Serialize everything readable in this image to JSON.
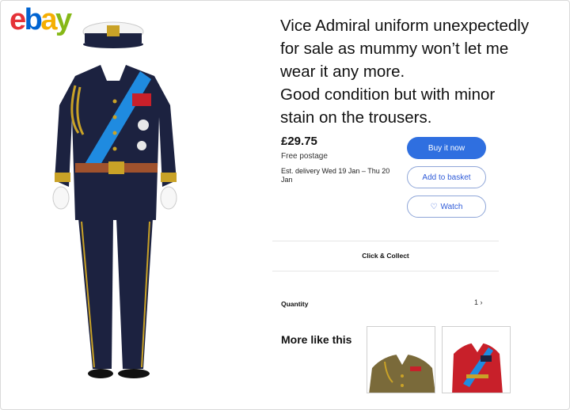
{
  "logo": {
    "letters": [
      "e",
      "b",
      "a",
      "y"
    ],
    "colors": [
      "#e53238",
      "#0064d2",
      "#f5af02",
      "#86b817"
    ]
  },
  "listing": {
    "title_lines": [
      "Vice Admiral uniform unexpectedly",
      "for sale as mummy won’t let me",
      "wear it any more.",
      "Good condition but with minor",
      "stain on the trousers."
    ],
    "price": "£29.75",
    "postage": "Free postage",
    "delivery": "Est. delivery Wed 19 Jan – Thu 20 Jan"
  },
  "buttons": {
    "buy_now": "Buy it now",
    "add_to_basket": "Add to basket",
    "watch": "Watch",
    "watch_icon": "heart-icon"
  },
  "collect": "Click & Collect",
  "quantity": {
    "label": "Quantity",
    "value": "1 ›"
  },
  "more_like_this": "More like this",
  "colors": {
    "accent": "#2f6fe0",
    "navy": "#1c2240",
    "sash": "#1f8be0",
    "gold": "#c9a227",
    "red_tunic": "#c8202a"
  }
}
